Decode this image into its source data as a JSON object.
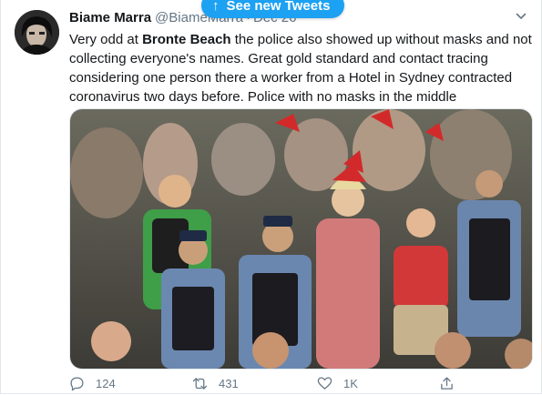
{
  "tweet": {
    "author_name": "Biame Marra",
    "author_handle": "@BiameMarra",
    "date": "Dec 26",
    "text_parts": [
      "Very odd at ",
      "Bronte Beach",
      " the police also showed up without masks and not collecting everyone's names. Great gold standard and contact tracing considering one person there a worker from a Hotel in Sydney contracted coronavirus two days before. Police with no masks in the middle"
    ]
  },
  "banner": {
    "label": "See new Tweets",
    "icon": "arrow-up-icon"
  },
  "actions": {
    "reply_count": "124",
    "retweet_count": "431",
    "like_count": "1K"
  },
  "colors": {
    "accent": "#1da1f2",
    "secondary_text": "#657786",
    "border": "#e1e8ed"
  }
}
